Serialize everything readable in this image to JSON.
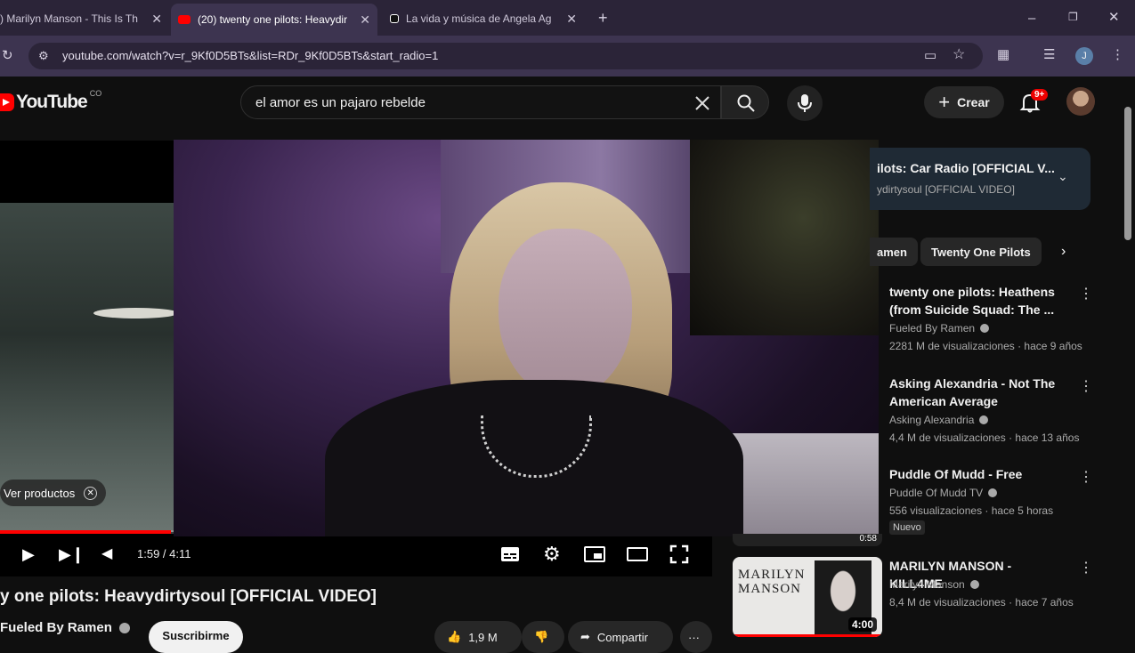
{
  "browser": {
    "tabs": [
      {
        "title": ") Marilyn Manson - This Is Th",
        "close": "✕"
      },
      {
        "title": "(20) twenty one pilots: Heavydir",
        "close": "✕"
      },
      {
        "title": "La vida y música de Angela Ag",
        "close": "✕"
      }
    ],
    "new_tab": "+",
    "url": "youtube.com/watch?v=r_9Kf0D5BTs&list=RDr_9Kf0D5BTs&start_radio=1",
    "profile_initial": "J"
  },
  "header": {
    "logo_text": "YouTube",
    "country": "CO",
    "search_value": "el amor es un pajaro rebelde",
    "create_label": "Crear",
    "notif_badge": "9+"
  },
  "player": {
    "ver_productos": "Ver productos",
    "time": "1:59 / 4:11",
    "progress": 0.24
  },
  "video": {
    "title": "y one pilots: Heavydirtysoul [OFFICIAL VIDEO]",
    "channel": "Fueled By Ramen",
    "subscribe": "Suscribirme",
    "likes": "1,9 M",
    "share": "Compartir",
    "more": "···"
  },
  "sidebar": {
    "playlist_title": "ilots: Car Radio [OFFICIAL V...",
    "playlist_sub": "ydirtysoul [OFFICIAL VIDEO]",
    "chips": [
      "amen",
      "Twenty One Pilots"
    ],
    "recs": [
      {
        "title": "twenty one pilots: Heathens (from Suicide Squad: The ...",
        "channel": "Fueled By Ramen",
        "meta": "2281 M de visualizaciones · hace 9 años"
      },
      {
        "title": "Asking Alexandria - Not The American Average",
        "channel": "Asking Alexandria",
        "meta": "4,4 M de visualizaciones · hace 13 años"
      },
      {
        "title": "Puddle Of Mudd - Free",
        "channel": "Puddle Of Mudd TV",
        "meta": "556 visualizaciones · hace 5 horas",
        "badge": "Nuevo"
      },
      {
        "title": "MARILYN MANSON - KILL4ME",
        "channel": "Marilyn Manson",
        "meta": "8,4 M de visualizaciones · hace 7 años"
      }
    ],
    "thumb_logo_line1": "MARILYN",
    "thumb_logo_line2": "MANSON",
    "thumb_duration": "4:00",
    "prev_thumb_duration": "0:58"
  }
}
